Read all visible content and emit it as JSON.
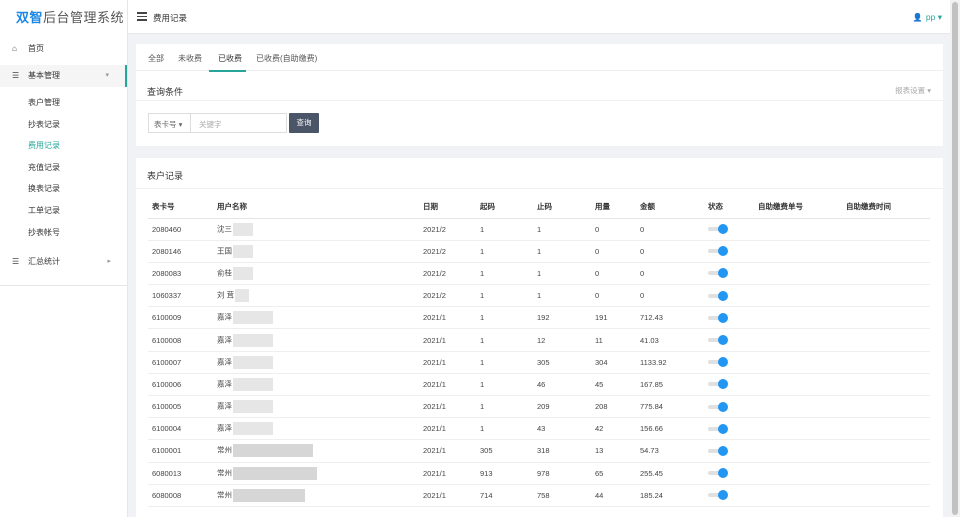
{
  "brand": {
    "part1": "双智",
    "part2": "后台管理系统"
  },
  "sidebar": {
    "home": "首页",
    "basic": "基本管理",
    "subs": [
      "表户管理",
      "抄表记录",
      "费用记录",
      "充值记录",
      "换表记录",
      "工单记录",
      "抄表帐号"
    ],
    "stats": "汇总统计"
  },
  "topbar": {
    "title": "费用记录",
    "user": "pp"
  },
  "tabs": [
    "全部",
    "未收费",
    "已收费",
    "已收费(自助缴费)"
  ],
  "query": {
    "title": "查询条件",
    "report_settings": "报表设置",
    "select_value": "表卡号",
    "input_placeholder": "关键字",
    "search_button": "查询"
  },
  "table": {
    "title": "表户记录",
    "headers": [
      "表卡号",
      "用户名称",
      "日期",
      "起码",
      "止码",
      "用量",
      "金额",
      "状态",
      "自助缴费单号",
      "自助缴费时间"
    ],
    "rows": [
      {
        "card": "2080460",
        "name": "沈三",
        "date": "2021/2",
        "start": "1",
        "end": "1",
        "usage": "0",
        "amount": "0"
      },
      {
        "card": "2080146",
        "name": "王国",
        "date": "2021/2",
        "start": "1",
        "end": "1",
        "usage": "0",
        "amount": "0"
      },
      {
        "card": "2080083",
        "name": "俞桂",
        "date": "2021/2",
        "start": "1",
        "end": "1",
        "usage": "0",
        "amount": "0"
      },
      {
        "card": "1060337",
        "name": "刘 茸",
        "date": "2021/2",
        "start": "1",
        "end": "1",
        "usage": "0",
        "amount": "0"
      },
      {
        "card": "6100009",
        "name": "嘉泽",
        "date": "2021/1",
        "start": "1",
        "end": "192",
        "usage": "191",
        "amount": "712.43"
      },
      {
        "card": "6100008",
        "name": "嘉泽",
        "date": "2021/1",
        "start": "1",
        "end": "12",
        "usage": "11",
        "amount": "41.03"
      },
      {
        "card": "6100007",
        "name": "嘉泽",
        "date": "2021/1",
        "start": "1",
        "end": "305",
        "usage": "304",
        "amount": "1133.92"
      },
      {
        "card": "6100006",
        "name": "嘉泽",
        "date": "2021/1",
        "start": "1",
        "end": "46",
        "usage": "45",
        "amount": "167.85"
      },
      {
        "card": "6100005",
        "name": "嘉泽",
        "date": "2021/1",
        "start": "1",
        "end": "209",
        "usage": "208",
        "amount": "775.84"
      },
      {
        "card": "6100004",
        "name": "嘉泽",
        "date": "2021/1",
        "start": "1",
        "end": "43",
        "usage": "42",
        "amount": "156.66"
      },
      {
        "card": "6100001",
        "name": "常州",
        "date": "2021/1",
        "start": "305",
        "end": "318",
        "usage": "13",
        "amount": "54.73"
      },
      {
        "card": "6080013",
        "name": "常州",
        "date": "2021/1",
        "start": "913",
        "end": "978",
        "usage": "65",
        "amount": "255.45"
      },
      {
        "card": "6080008",
        "name": "常州",
        "date": "2021/1",
        "start": "714",
        "end": "758",
        "usage": "44",
        "amount": "185.24"
      }
    ]
  },
  "colors": {
    "accent": "#26a69a",
    "brand": "#1e88e5",
    "toggle": "#2196f3",
    "button": "#4a5568"
  }
}
